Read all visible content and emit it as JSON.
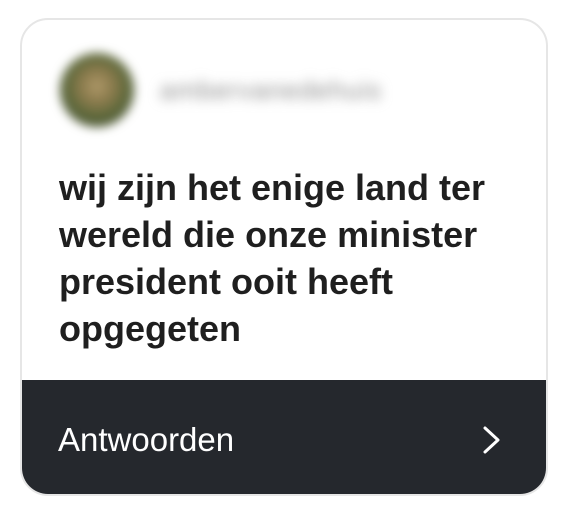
{
  "post": {
    "username": "ambervanedehuis",
    "question": "wij zijn het enige land ter wereld die onze minister president ooit heeft opgegeten",
    "reply_label": "Antwoorden"
  },
  "icons": {
    "avatar": "avatar",
    "chevron": "chevron-right-icon"
  },
  "colors": {
    "reply_bar": "#25282d",
    "question_text": "#1f1f1f",
    "card_border": "#e6e6e6"
  }
}
